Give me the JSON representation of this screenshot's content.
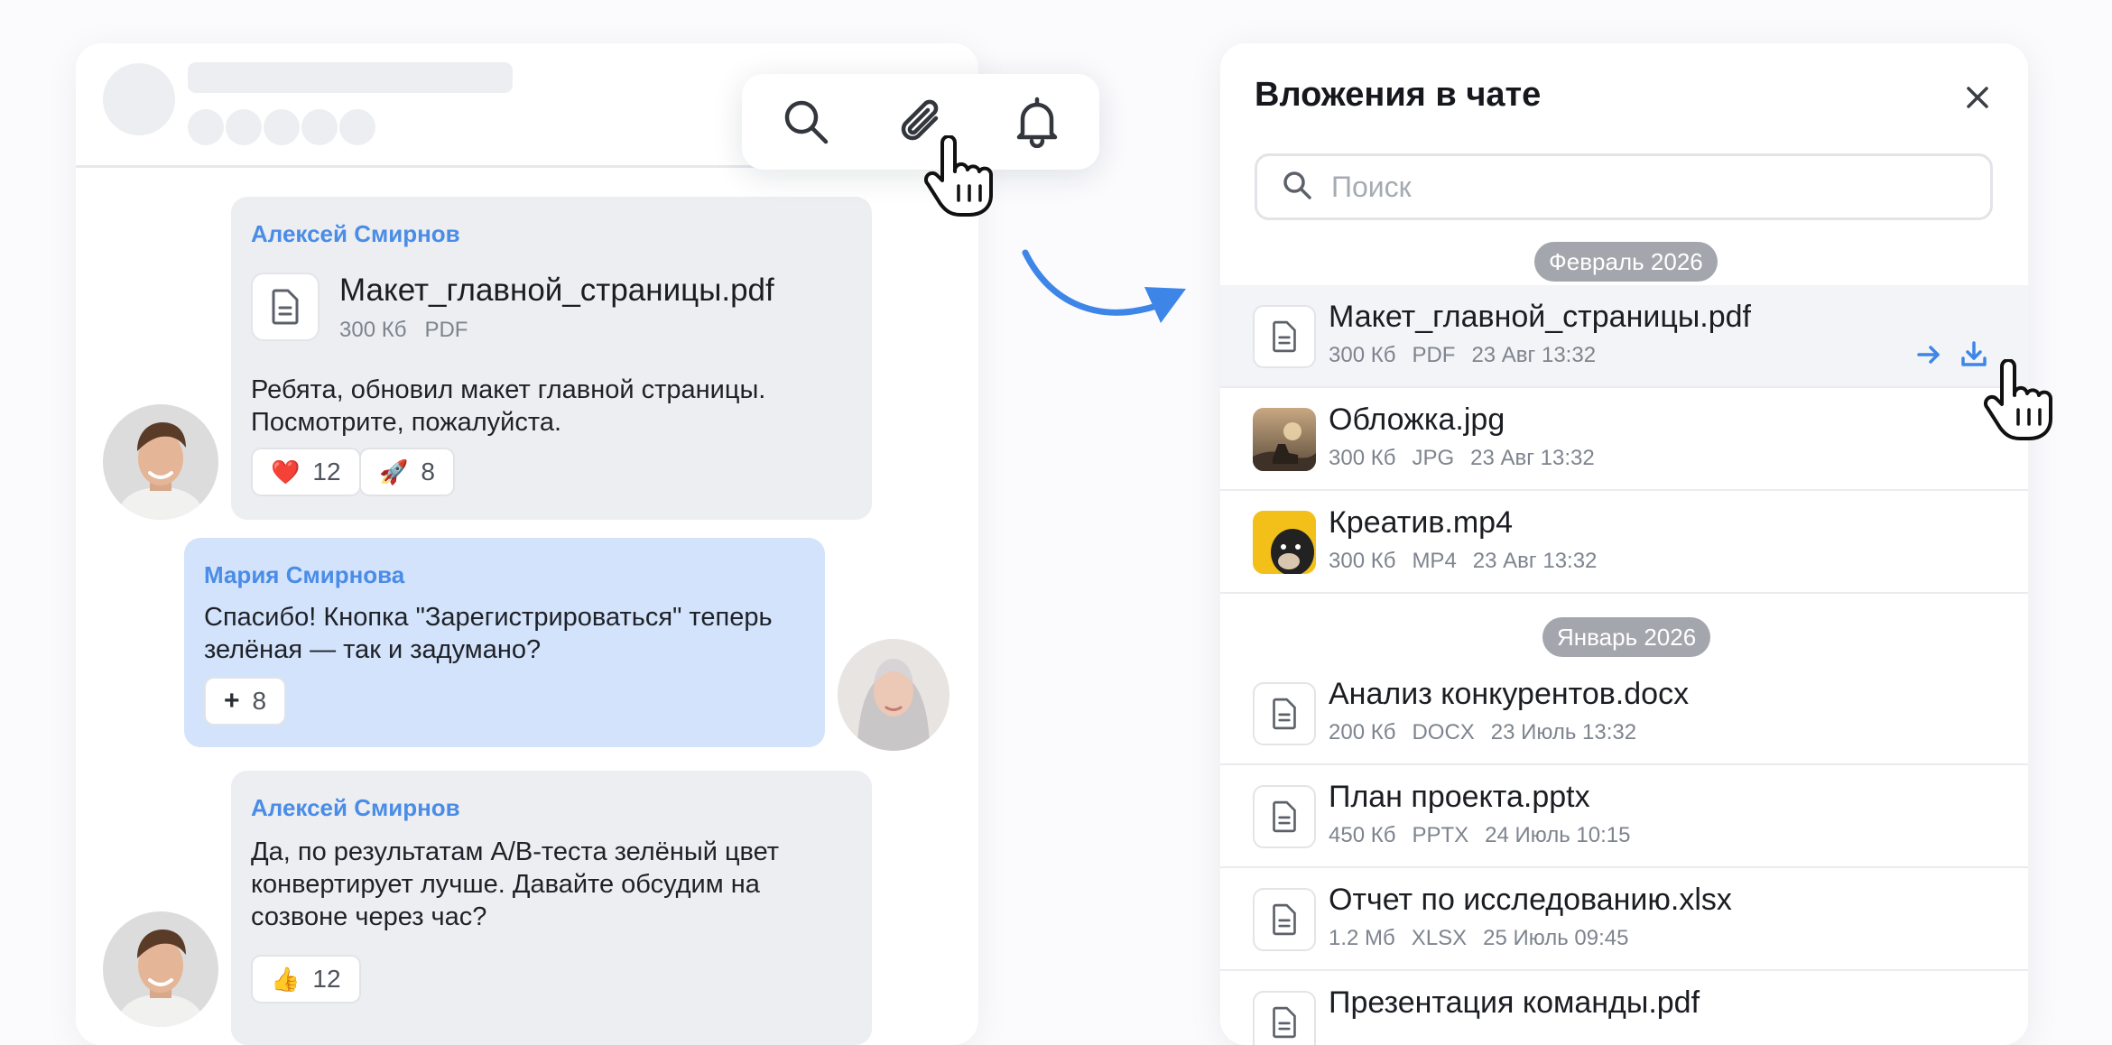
{
  "chat": {
    "messages": [
      {
        "sender": "Алексей Смирнов",
        "file": {
          "name": "Макет_главной_страницы.pdf",
          "size": "300 Кб",
          "type": "PDF"
        },
        "text_line1": "Ребята, обновил макет главной страницы.",
        "text_line2": "Посмотрите, пожалуйста.",
        "reactions": [
          {
            "emoji": "❤️",
            "count": "12"
          },
          {
            "emoji": "🚀",
            "count": "8"
          }
        ]
      },
      {
        "sender": "Мария Смирнова",
        "text_line1": "Спасибо! Кнопка \"Зарегистрироваться\" теперь",
        "text_line2": "зелёная — так и задумано?",
        "reactions": [
          {
            "emoji": "+",
            "count": "8"
          }
        ]
      },
      {
        "sender": "Алексей Смирнов",
        "text_line1": "Да, по результатам A/B-теста зелёный цвет",
        "text_line2": "конвертирует лучше. Давайте обсудим на",
        "text_line3": "созвоне через час?",
        "reactions": [
          {
            "emoji": "👍",
            "count": "12"
          }
        ]
      }
    ]
  },
  "toolbar": {
    "icons": [
      "search-icon",
      "paperclip-icon",
      "bell-icon"
    ]
  },
  "attachments": {
    "title": "Вложения в чате",
    "search_placeholder": "Поиск",
    "groups": [
      {
        "date": "Февраль 2026",
        "items": [
          {
            "name": "Макет_главной_страницы.pdf",
            "size": "300 Кб",
            "type": "PDF",
            "date": "23 Авг 13:32",
            "kind": "document"
          },
          {
            "name": "Обложка.jpg",
            "size": "300 Кб",
            "type": "JPG",
            "date": "23 Авг 13:32",
            "kind": "image"
          },
          {
            "name": "Креатив.mp4",
            "size": "300 Кб",
            "type": "MP4",
            "date": "23 Авг 13:32",
            "kind": "video"
          }
        ]
      },
      {
        "date": "Январь 2026",
        "items": [
          {
            "name": "Анализ конкурентов.docx",
            "size": "200 Кб",
            "type": "DOCX",
            "date": "23 Июль 13:32",
            "kind": "document"
          },
          {
            "name": "План проекта.pptx",
            "size": "450 Кб",
            "type": "PPTX",
            "date": "24 Июль 10:15",
            "kind": "document"
          },
          {
            "name": "Отчет по исследованию.xlsx",
            "size": "1.2 Мб",
            "type": "XLSX",
            "date": "25 Июль 09:45",
            "kind": "document"
          },
          {
            "name": "Презентация команды.pdf",
            "kind": "document"
          }
        ]
      }
    ]
  },
  "colors": {
    "accent": "#3d86e8",
    "blue_bubble": "#d3e3fb",
    "grey_bubble": "#eceef2",
    "badge": "#a3a6ad"
  }
}
